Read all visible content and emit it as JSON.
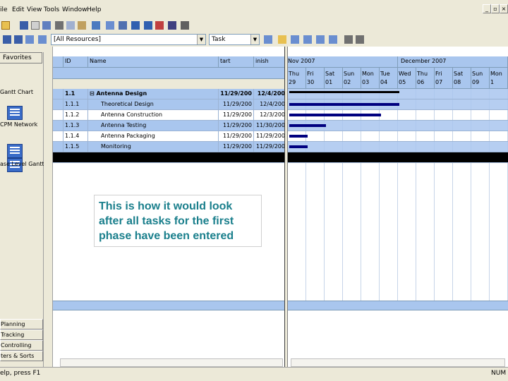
{
  "menu": [
    "ile",
    "Edit",
    "View",
    "Tools",
    "Window",
    "Help"
  ],
  "toolbar": {
    "resource_filter": "[All Resources]",
    "view_combo": "Task"
  },
  "sidebar": {
    "favorites_label": "Favorites",
    "views": [
      "Gantt Chart",
      "CPM Network",
      "ase Level Gantt"
    ],
    "phases": [
      "Planning",
      "Tracking",
      "Controlling",
      "ters & Sorts"
    ]
  },
  "columns": {
    "id": "ID",
    "name": "Name",
    "start": "tart",
    "finish": "inish"
  },
  "tasks": [
    {
      "id": "1.1",
      "name": "Antenna Design",
      "start": "11/29/200",
      "finish": "12/4/200",
      "summary": true
    },
    {
      "id": "1.1.1",
      "name": "Theoretical Design",
      "start": "11/29/200",
      "finish": "12/4/200",
      "summary": false
    },
    {
      "id": "1.1.2",
      "name": "Antenna Construction",
      "start": "11/29/200",
      "finish": "12/3/200",
      "summary": false
    },
    {
      "id": "1.1.3",
      "name": "Antenna Testing",
      "start": "11/29/200",
      "finish": "11/30/200",
      "summary": false
    },
    {
      "id": "1.1.4",
      "name": "Antenna Packaging",
      "start": "11/29/200",
      "finish": "11/29/200",
      "summary": false
    },
    {
      "id": "1.1.5",
      "name": "Monitoring",
      "start": "11/29/200",
      "finish": "11/29/200",
      "summary": false
    }
  ],
  "timescale": {
    "months": [
      "Nov 2007",
      "December 2007"
    ],
    "days": [
      {
        "d": "Thu",
        "n": "29"
      },
      {
        "d": "Fri",
        "n": "30"
      },
      {
        "d": "Sat",
        "n": "01"
      },
      {
        "d": "Sun",
        "n": "02"
      },
      {
        "d": "Mon",
        "n": "03"
      },
      {
        "d": "Tue",
        "n": "04"
      },
      {
        "d": "Wed",
        "n": "05"
      },
      {
        "d": "Thu",
        "n": "06"
      },
      {
        "d": "Fri",
        "n": "07"
      },
      {
        "d": "Sat",
        "n": "08"
      },
      {
        "d": "Sun",
        "n": "09"
      },
      {
        "d": "Mon",
        "n": "1"
      }
    ]
  },
  "bars_days": [
    {
      "start": 0,
      "days": 6,
      "summary": true
    },
    {
      "start": 0,
      "days": 6
    },
    {
      "start": 0,
      "days": 5
    },
    {
      "start": 0,
      "days": 2
    },
    {
      "start": 0,
      "days": 1
    },
    {
      "start": 0,
      "days": 1
    }
  ],
  "note": "This is how it would look after all tasks for the first phase have been entered",
  "status": {
    "left": "elp, press F1",
    "right": "NUM"
  }
}
